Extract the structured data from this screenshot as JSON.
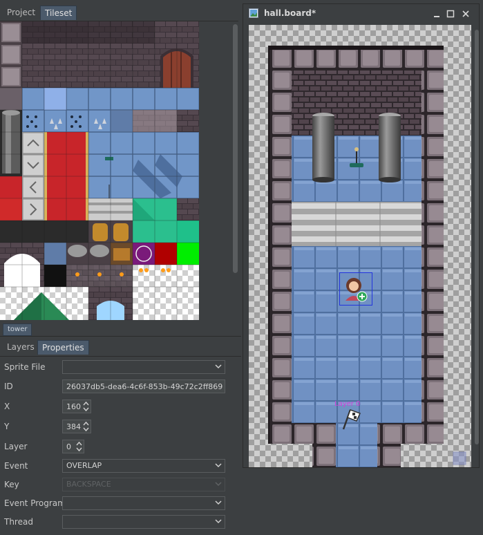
{
  "left_tabs": [
    {
      "label": "Project"
    },
    {
      "label": "Tileset"
    }
  ],
  "tileset_tab": "tower",
  "bottom_tabs": [
    {
      "label": "Layers"
    },
    {
      "label": "Properties"
    }
  ],
  "properties": {
    "sprite_file": {
      "label": "Sprite File",
      "value": ""
    },
    "id": {
      "label": "ID",
      "value": "26037db5-dea6-4c6f-853b-49c72c2ff869"
    },
    "x": {
      "label": "X",
      "value": "160"
    },
    "y": {
      "label": "Y",
      "value": "384"
    },
    "layer": {
      "label": "Layer",
      "value": "0"
    },
    "event": {
      "label": "Event",
      "value": "OVERLAP"
    },
    "key": {
      "label": "Key",
      "value": "BACKSPACE"
    },
    "event_program": {
      "label": "Event Program",
      "value": ""
    },
    "thread": {
      "label": "Thread",
      "value": ""
    }
  },
  "window": {
    "title": "hall.board*",
    "icons": [
      "board-file-icon",
      "minimize-icon",
      "maximize-icon",
      "close-icon"
    ]
  },
  "board": {
    "start_label": "Layer 0",
    "icons": [
      "npc-sprite-icon",
      "start-flag-icon"
    ]
  },
  "colors": {
    "active_tab": "#4b5a6b",
    "floor": "#6f8fbf",
    "wall": "#3b3238",
    "carpet": "#c8252a",
    "selection": "#2233dd",
    "layer_label": "#d23cd8"
  }
}
